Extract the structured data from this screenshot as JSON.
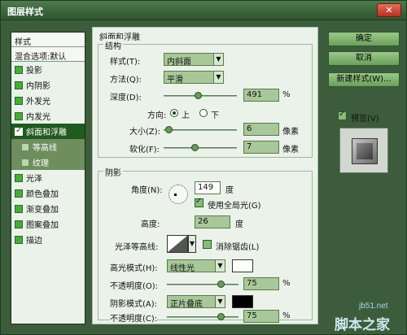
{
  "window": {
    "title": "图层样式",
    "close_symbol": "✕"
  },
  "styles_list": {
    "header": "样式",
    "blend_options": "混合选项:默认",
    "items": [
      {
        "label": "投影",
        "checked": false
      },
      {
        "label": "内阴影",
        "checked": false
      },
      {
        "label": "外发光",
        "checked": false
      },
      {
        "label": "内发光",
        "checked": false
      },
      {
        "label": "斜面和浮雕",
        "checked": true,
        "selected": true
      },
      {
        "label": "等高线",
        "checked": false,
        "sub": true
      },
      {
        "label": "纹理",
        "checked": false,
        "sub": true
      },
      {
        "label": "光泽",
        "checked": false
      },
      {
        "label": "颜色叠加",
        "checked": false
      },
      {
        "label": "渐变叠加",
        "checked": false
      },
      {
        "label": "图案叠加",
        "checked": false
      },
      {
        "label": "描边",
        "checked": false
      }
    ]
  },
  "bevel": {
    "section_title": "斜面和浮雕",
    "structure_title": "结构",
    "style_label": "样式(T):",
    "style_value": "内斜面",
    "technique_label": "方法(Q):",
    "technique_value": "平滑",
    "depth_label": "深度(D):",
    "depth_value": "491",
    "depth_unit": "%",
    "direction_label": "方向:",
    "direction_up": "上",
    "direction_down": "下",
    "size_label": "大小(Z):",
    "size_value": "6",
    "size_unit": "像素",
    "soften_label": "软化(F):",
    "soften_value": "7",
    "soften_unit": "像素"
  },
  "shading": {
    "title": "阴影",
    "angle_label": "角度(N):",
    "angle_value": "149",
    "angle_unit": "度",
    "global_light_label": "使用全局光(G)",
    "altitude_label": "高度:",
    "altitude_value": "26",
    "altitude_unit": "度",
    "gloss_label": "光泽等高线:",
    "antialias_label": "消除锯齿(L)",
    "highlight_mode_label": "高光模式(H):",
    "highlight_mode_value": "线性光",
    "highlight_opacity_label": "不透明度(O):",
    "highlight_opacity_value": "75",
    "highlight_opacity_unit": "%",
    "highlight_color": "#ffffff",
    "shadow_mode_label": "阴影模式(A):",
    "shadow_mode_value": "正片叠底",
    "shadow_opacity_label": "不透明度(C):",
    "shadow_opacity_value": "75",
    "shadow_opacity_unit": "%",
    "shadow_color": "#000000"
  },
  "actions": {
    "ok": "确定",
    "cancel": "取消",
    "new_style": "新建样式(W)...",
    "preview": "预览(V)"
  },
  "watermark": {
    "site": "jb51.net",
    "brand": "脚本之家"
  }
}
